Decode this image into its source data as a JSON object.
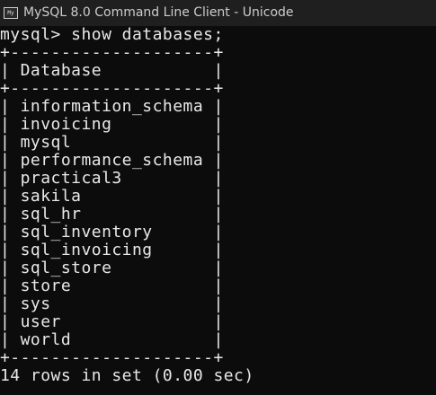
{
  "window": {
    "title": "MySQL 8.0 Command Line Client - Unicode",
    "icon": "mysql-console-icon",
    "icon_text": "My"
  },
  "console": {
    "command_line": "mysql> show databases;",
    "border_line": "+--------------------+",
    "header_line": "| Database           |",
    "rows": [
      "| information_schema |",
      "| invoicing          |",
      "| mysql              |",
      "| performance_schema |",
      "| practical3         |",
      "| sakila             |",
      "| sql_hr             |",
      "| sql_inventory      |",
      "| sql_invoicing      |",
      "| sql_store          |",
      "| store              |",
      "| sys                |",
      "| user               |",
      "| world              |"
    ],
    "result_summary": "14 rows in set (0.00 sec)"
  },
  "colors": {
    "background": "#0c0c0c",
    "titlebar": "#1f1f1f",
    "text": "#e8e8e8"
  }
}
